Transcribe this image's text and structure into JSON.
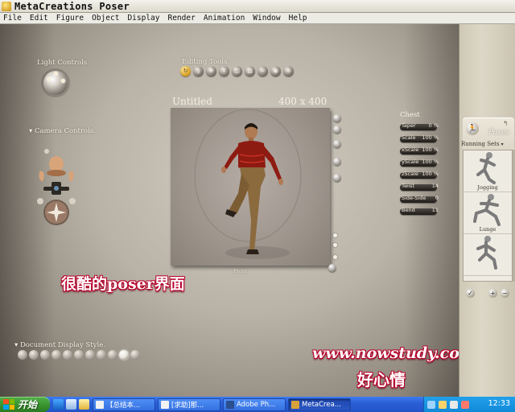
{
  "window": {
    "title": "MetaCreations Poser"
  },
  "menu": [
    "File",
    "Edit",
    "Figure",
    "Object",
    "Display",
    "Render",
    "Animation",
    "Window",
    "Help"
  ],
  "panels": {
    "light_controls": "Light Controls.",
    "editing_tools": "Editing Tools.",
    "camera_controls": "Camera Controls.",
    "document_display_style": "Document Display Style."
  },
  "document": {
    "title": "Untitled",
    "size": "400 x 400",
    "camera_label": "Front"
  },
  "parameters": {
    "group": "Chest",
    "dials": [
      {
        "name": "Taper",
        "value": "0 %"
      },
      {
        "name": "Scale",
        "value": "100 %"
      },
      {
        "name": "xScale",
        "value": "100 %"
      },
      {
        "name": "yScale",
        "value": "100 %"
      },
      {
        "name": "zScale",
        "value": "100 %"
      },
      {
        "name": "Twist",
        "value": "14"
      },
      {
        "name": "Side-Side",
        "value": "0"
      },
      {
        "name": "Bend",
        "value": "11"
      }
    ]
  },
  "library": {
    "tab": "Poses",
    "category": "Running Sets",
    "items": [
      {
        "label": "Jogging"
      },
      {
        "label": "Lunge"
      },
      {
        "label": ""
      }
    ]
  },
  "overlay": {
    "caption": "很酷的poser界面",
    "site": "www.nowstudy.com",
    "name": "好心情"
  },
  "taskbar": {
    "start": "开始",
    "tasks": [
      {
        "label": "【总结本..."
      },
      {
        "label": "[求助]那..."
      },
      {
        "label": "Adobe Ph..."
      },
      {
        "label": "MetaCrea..."
      }
    ],
    "clock": "12:33"
  },
  "colors": {
    "accent_red": "#b8002a",
    "taskbar_blue": "#2a5fd7",
    "start_green": "#36912d",
    "active_tool_gold": "#d49a1c"
  }
}
